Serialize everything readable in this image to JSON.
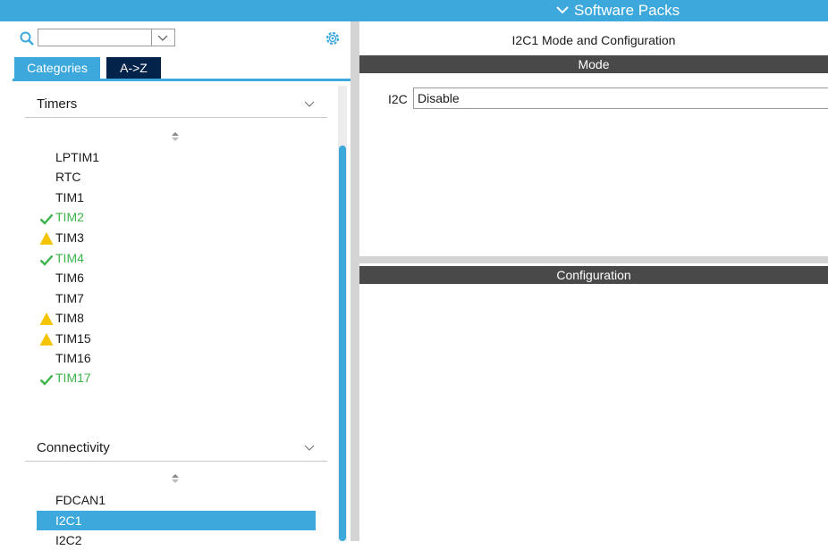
{
  "header": {
    "software_packs": "Software Packs"
  },
  "sidebar": {
    "search": {
      "value": "",
      "placeholder": ""
    },
    "tabs": {
      "categories": "Categories",
      "a_to_z": "A->Z"
    },
    "sections": [
      {
        "title": "Timers",
        "items": [
          {
            "label": "LPTIM1",
            "status": "none"
          },
          {
            "label": "RTC",
            "status": "none"
          },
          {
            "label": "TIM1",
            "status": "none"
          },
          {
            "label": "TIM2",
            "status": "ok"
          },
          {
            "label": "TIM3",
            "status": "warning"
          },
          {
            "label": "TIM4",
            "status": "ok"
          },
          {
            "label": "TIM6",
            "status": "none"
          },
          {
            "label": "TIM7",
            "status": "none"
          },
          {
            "label": "TIM8",
            "status": "warning"
          },
          {
            "label": "TIM15",
            "status": "warning"
          },
          {
            "label": "TIM16",
            "status": "none"
          },
          {
            "label": "TIM17",
            "status": "ok"
          }
        ]
      },
      {
        "title": "Connectivity",
        "items": [
          {
            "label": "FDCAN1",
            "status": "none"
          },
          {
            "label": "I2C1",
            "status": "selected"
          },
          {
            "label": "I2C2",
            "status": "none"
          }
        ]
      }
    ]
  },
  "main": {
    "title": "I2C1 Mode and Configuration",
    "mode_header": "Mode",
    "i2c_label": "I2C",
    "i2c_value": "Disable",
    "configuration_header": "Configuration"
  },
  "colors": {
    "accent": "#3da8dc",
    "dark_tab": "#03234b",
    "ok_green": "#3bb44a",
    "warning_yellow": "#f5c400",
    "bar_gray": "#494949"
  }
}
